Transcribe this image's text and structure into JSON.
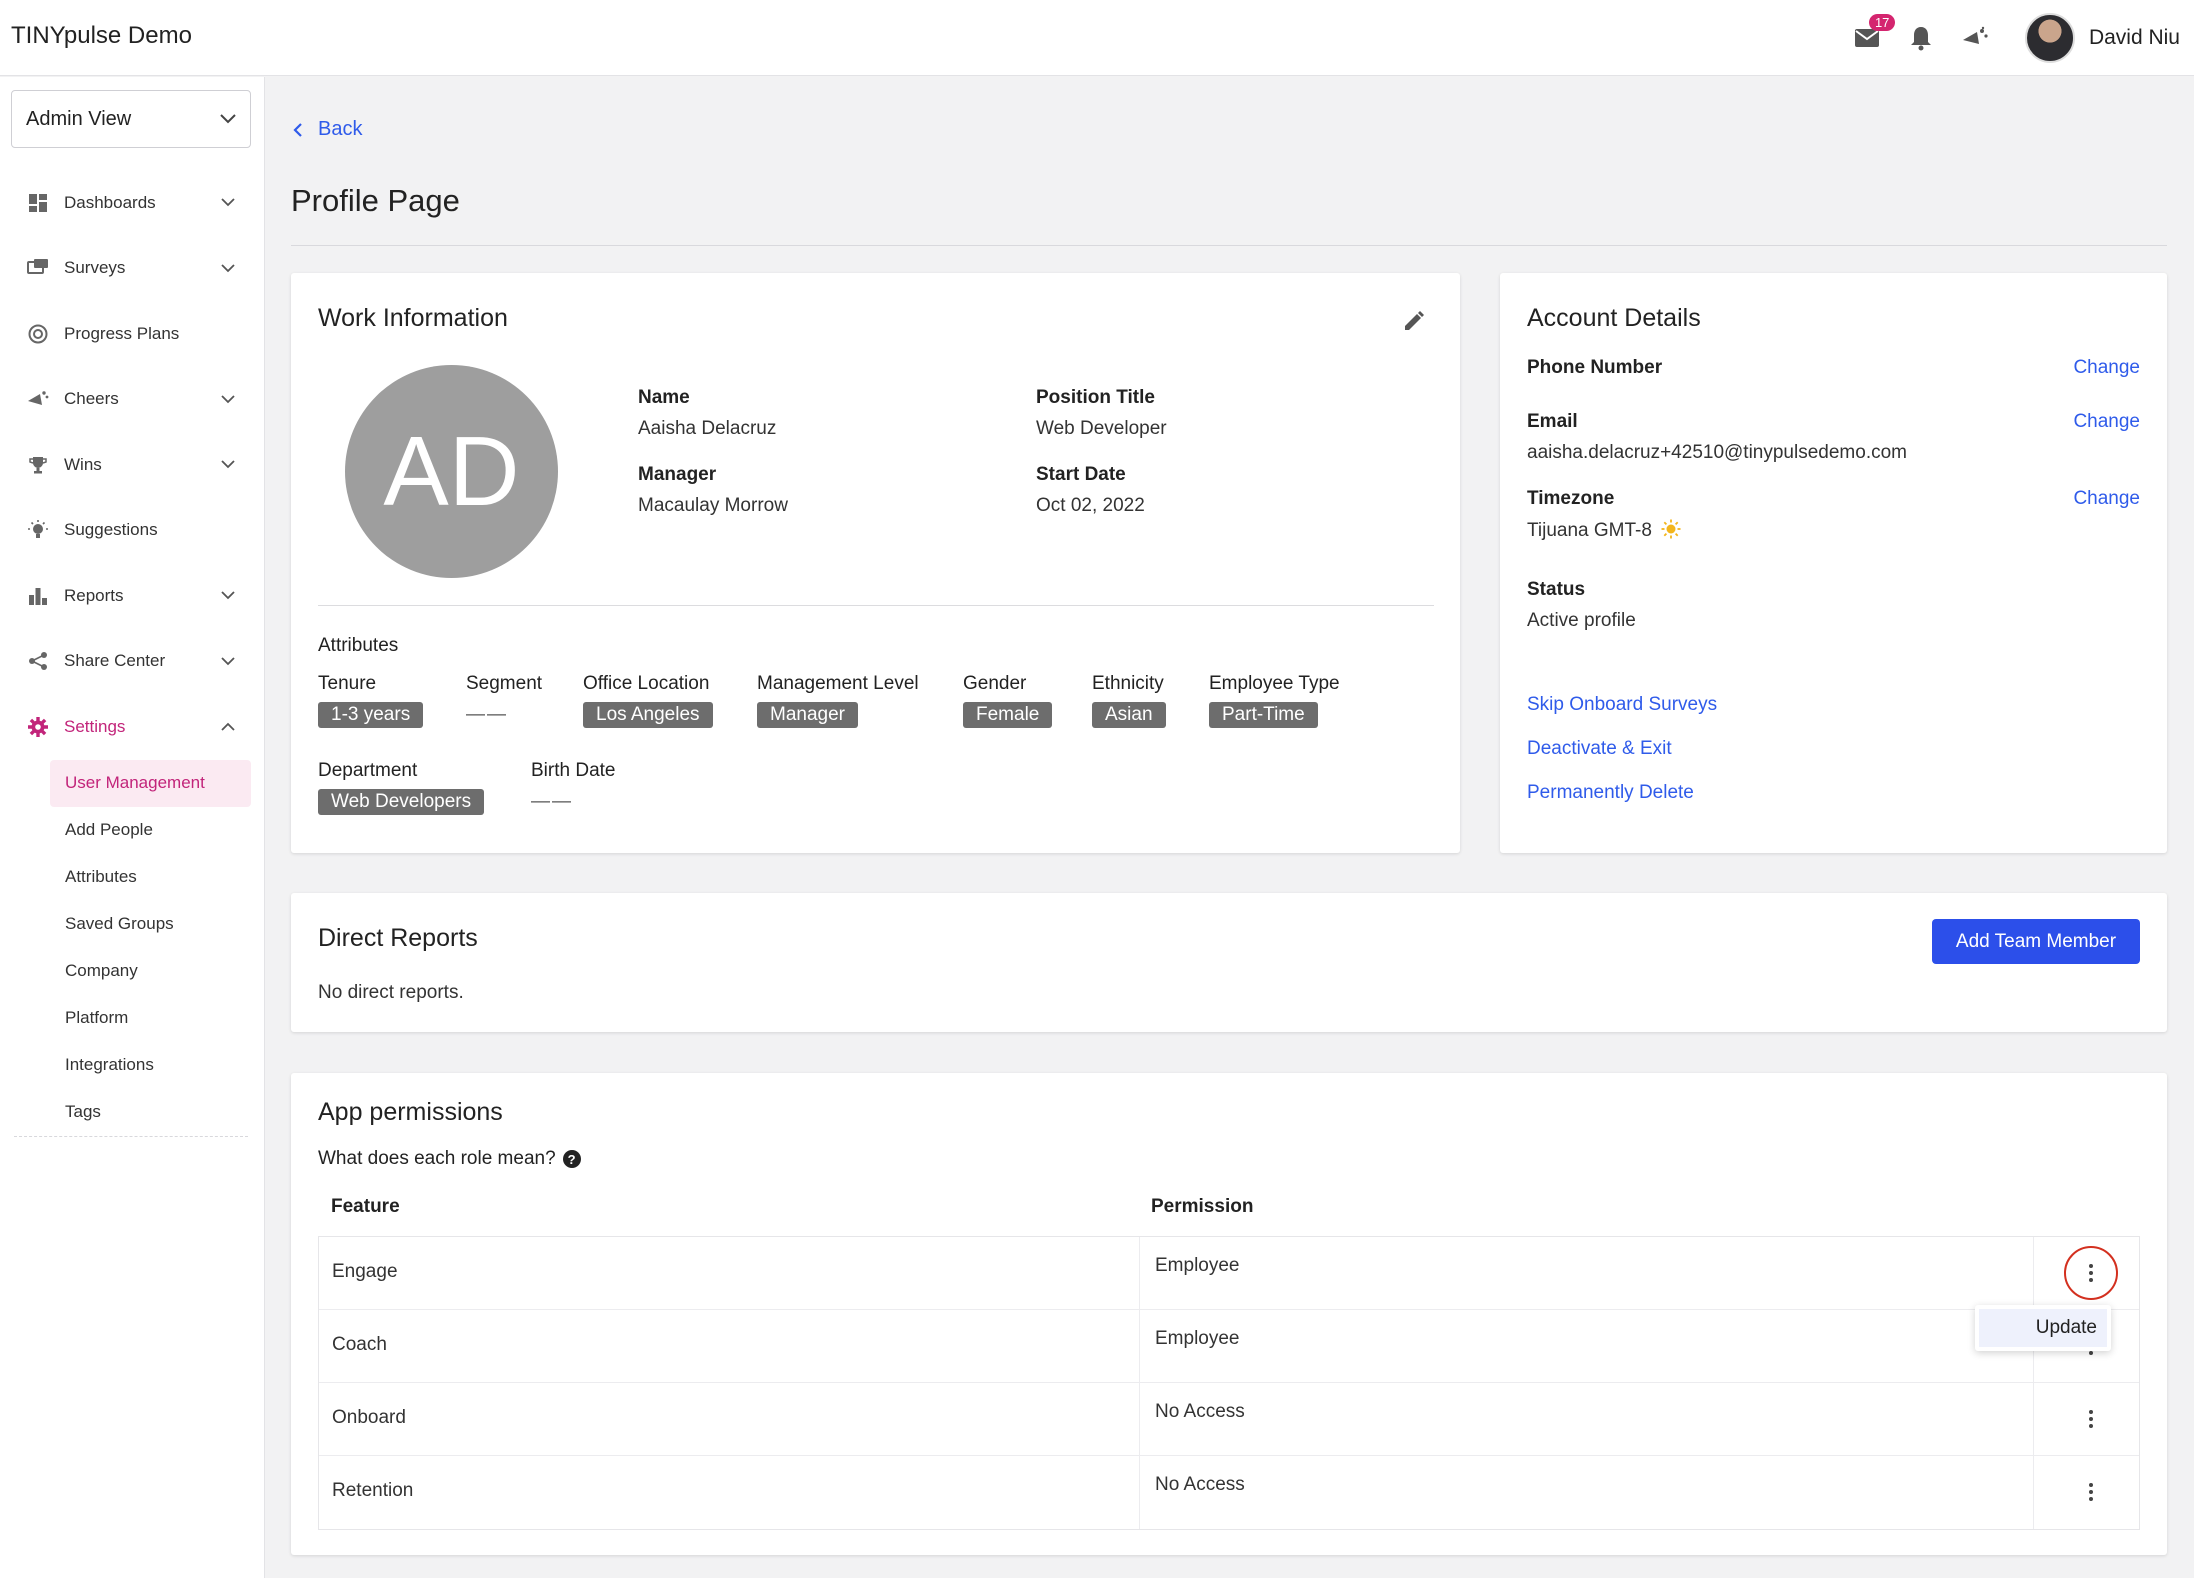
{
  "app": {
    "title": "TINYpulse Demo"
  },
  "header": {
    "mail_count": "17",
    "user_name": "David Niu"
  },
  "sidebar": {
    "view_select": "Admin View",
    "items": [
      {
        "label": "Dashboards",
        "icon": "dashboard-icon",
        "has_chevron": true
      },
      {
        "label": "Surveys",
        "icon": "survey-icon",
        "has_chevron": true
      },
      {
        "label": "Progress Plans",
        "icon": "target-icon",
        "has_chevron": false
      },
      {
        "label": "Cheers",
        "icon": "megaphone-icon",
        "has_chevron": true
      },
      {
        "label": "Wins",
        "icon": "trophy-icon",
        "has_chevron": true
      },
      {
        "label": "Suggestions",
        "icon": "lightbulb-icon",
        "has_chevron": false
      },
      {
        "label": "Reports",
        "icon": "bar-chart-icon",
        "has_chevron": true
      },
      {
        "label": "Share Center",
        "icon": "share-icon",
        "has_chevron": true
      },
      {
        "label": "Settings",
        "icon": "gear-icon",
        "has_chevron": true
      }
    ],
    "settings_sub": [
      "User Management",
      "Add People",
      "Attributes",
      "Saved Groups",
      "Company",
      "Platform",
      "Integrations",
      "Tags"
    ]
  },
  "page": {
    "back": "Back",
    "title": "Profile Page"
  },
  "work_info": {
    "title": "Work Information",
    "initials": "AD",
    "name_label": "Name",
    "name": "Aaisha Delacruz",
    "position_label": "Position Title",
    "position": "Web Developer",
    "manager_label": "Manager",
    "manager": "Macaulay Morrow",
    "start_label": "Start Date",
    "start": "Oct 02, 2022",
    "attributes_title": "Attributes",
    "attributes": {
      "tenure": {
        "label": "Tenure",
        "value": "1-3 years"
      },
      "segment": {
        "label": "Segment",
        "value": "——"
      },
      "office": {
        "label": "Office Location",
        "value": "Los Angeles"
      },
      "mgmt": {
        "label": "Management Level",
        "value": "Manager"
      },
      "gender": {
        "label": "Gender",
        "value": "Female"
      },
      "ethnicity": {
        "label": "Ethnicity",
        "value": "Asian"
      },
      "emp_type": {
        "label": "Employee Type",
        "value": "Part-Time"
      },
      "department": {
        "label": "Department",
        "value": "Web Developers"
      },
      "birth": {
        "label": "Birth Date",
        "value": "——"
      }
    }
  },
  "account": {
    "title": "Account Details",
    "phone_label": "Phone Number",
    "email_label": "Email",
    "email": "aaisha.delacruz+42510@tinypulsedemo.com",
    "tz_label": "Timezone",
    "tz": "Tijuana GMT-8",
    "status_label": "Status",
    "status": "Active profile",
    "change": "Change",
    "links": [
      "Skip Onboard Surveys",
      "Deactivate & Exit",
      "Permanently Delete"
    ]
  },
  "direct_reports": {
    "title": "Direct Reports",
    "empty": "No direct reports.",
    "add_button": "Add Team Member"
  },
  "permissions": {
    "title": "App permissions",
    "question": "What does each role mean?",
    "col_feature": "Feature",
    "col_permission": "Permission",
    "rows": [
      {
        "feature": "Engage",
        "permission": "Employee"
      },
      {
        "feature": "Coach",
        "permission": "Employee"
      },
      {
        "feature": "Onboard",
        "permission": "No Access"
      },
      {
        "feature": "Retention",
        "permission": "No Access"
      }
    ],
    "menu_option": "Update"
  },
  "colors": {
    "accent": "#2c4fea",
    "link": "#2f5bea",
    "active": "#c2247a",
    "badge": "#d4256f",
    "tag": "#6d6d6d"
  }
}
